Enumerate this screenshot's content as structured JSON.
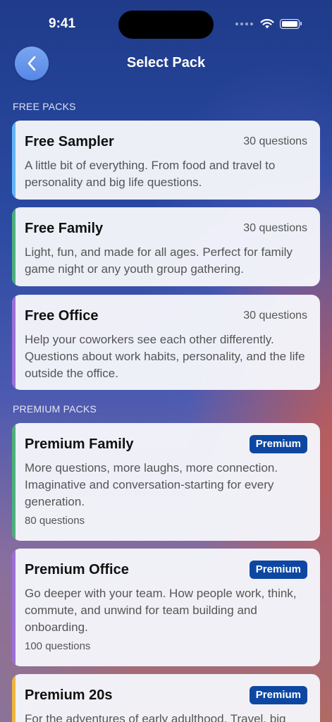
{
  "status": {
    "time": "9:41"
  },
  "nav": {
    "title": "Select Pack"
  },
  "sections": {
    "free": "FREE PACKS",
    "premium": "PREMIUM PACKS"
  },
  "free_packs": [
    {
      "title": "Free Sampler",
      "count": "30 questions",
      "description": "A little bit of everything. From food and travel to personality and big life questions.",
      "accent": "#64b5f6"
    },
    {
      "title": "Free Family",
      "count": "30 questions",
      "description": "Light, fun, and made for all ages. Perfect for family game night or any youth group gathering.",
      "accent": "#4caf7a"
    },
    {
      "title": "Free Office",
      "count": "30 questions",
      "description": "Help your coworkers see each other differently. Questions about work habits, personality, and the life outside the office.",
      "accent": "#9c6fd6"
    }
  ],
  "premium_packs": [
    {
      "title": "Premium Family",
      "badge": "Premium",
      "description": "More questions, more laughs, more connection. Imaginative and conversation-starting for every generation.",
      "count": "80 questions",
      "accent": "#4caf7a"
    },
    {
      "title": "Premium Office",
      "badge": "Premium",
      "description": "Go deeper with your team. How people work, think, commute, and unwind for team building and onboarding.",
      "count": "100 questions",
      "accent": "#9c6fd6"
    },
    {
      "title": "Premium 20s",
      "badge": "Premium",
      "description": "For the adventures of early adulthood. Travel, big",
      "accent": "#f0b53c"
    }
  ],
  "icons": {
    "back": "chevron-left-icon",
    "wifi": "wifi-icon",
    "battery": "battery-icon",
    "signal": "signal-icon"
  }
}
